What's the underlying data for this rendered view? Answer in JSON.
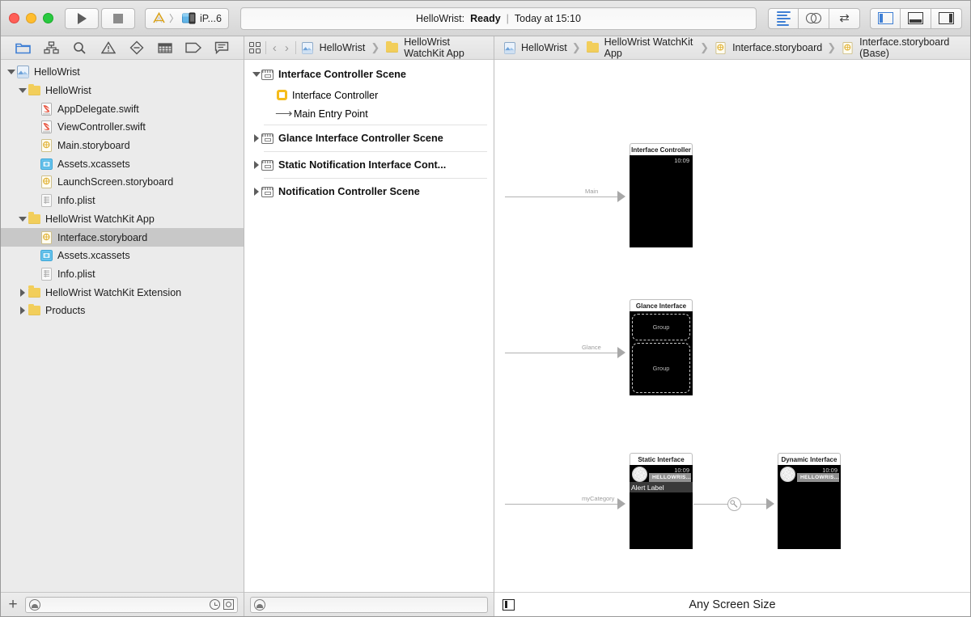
{
  "window": {
    "traffic_lights": [
      "close",
      "minimize",
      "zoom"
    ]
  },
  "toolbar": {
    "run_label": "Run",
    "stop_label": "Stop",
    "scheme": {
      "app_name": "HelloWrist",
      "separator": "〉",
      "destination": "iP...6"
    },
    "status": {
      "project": "HelloWrist:",
      "state": "Ready",
      "divider": "|",
      "time": "Today at 15:10"
    },
    "editor_modes": [
      {
        "name": "standard-editor",
        "icon": "lines-icon",
        "active": true
      },
      {
        "name": "assistant-editor",
        "icon": "venn-icon",
        "active": false
      },
      {
        "name": "version-editor",
        "icon": "arrows-icon",
        "active": false
      }
    ],
    "view_toggles": [
      {
        "name": "navigator-toggle",
        "icon": "left-pane-icon",
        "active": true
      },
      {
        "name": "debug-toggle",
        "icon": "bottom-pane-icon",
        "active": false
      },
      {
        "name": "utilities-toggle",
        "icon": "right-pane-icon",
        "active": false
      }
    ]
  },
  "navigator": {
    "tabs": [
      {
        "name": "project-navigator",
        "icon": "folder-icon",
        "active": true
      },
      {
        "name": "symbol-navigator",
        "icon": "hierarchy-icon",
        "active": false
      },
      {
        "name": "find-navigator",
        "icon": "search-icon",
        "active": false
      },
      {
        "name": "issue-navigator",
        "icon": "warning-icon",
        "active": false
      },
      {
        "name": "test-navigator",
        "icon": "diamond-icon",
        "active": false
      },
      {
        "name": "debug-navigator",
        "icon": "debug-icon",
        "active": false
      },
      {
        "name": "breakpoint-navigator",
        "icon": "tag-icon",
        "active": false
      },
      {
        "name": "report-navigator",
        "icon": "speech-icon",
        "active": false
      }
    ],
    "tree": [
      {
        "label": "HelloWrist",
        "indent": 0,
        "twisty": "down",
        "icon": "project-icon",
        "selected": false
      },
      {
        "label": "HelloWrist",
        "indent": 1,
        "twisty": "down",
        "icon": "folder-icon",
        "selected": false
      },
      {
        "label": "AppDelegate.swift",
        "indent": 2,
        "twisty": "none",
        "icon": "swift-icon",
        "selected": false
      },
      {
        "label": "ViewController.swift",
        "indent": 2,
        "twisty": "none",
        "icon": "swift-icon",
        "selected": false
      },
      {
        "label": "Main.storyboard",
        "indent": 2,
        "twisty": "none",
        "icon": "storyboard-icon",
        "selected": false
      },
      {
        "label": "Assets.xcassets",
        "indent": 2,
        "twisty": "none",
        "icon": "xcassets-icon",
        "selected": false
      },
      {
        "label": "LaunchScreen.storyboard",
        "indent": 2,
        "twisty": "none",
        "icon": "storyboard-icon",
        "selected": false
      },
      {
        "label": "Info.plist",
        "indent": 2,
        "twisty": "none",
        "icon": "plist-icon",
        "selected": false
      },
      {
        "label": "HelloWrist WatchKit App",
        "indent": 1,
        "twisty": "down",
        "icon": "folder-icon",
        "selected": false
      },
      {
        "label": "Interface.storyboard",
        "indent": 2,
        "twisty": "none",
        "icon": "storyboard-icon",
        "selected": true
      },
      {
        "label": "Assets.xcassets",
        "indent": 2,
        "twisty": "none",
        "icon": "xcassets-icon",
        "selected": false
      },
      {
        "label": "Info.plist",
        "indent": 2,
        "twisty": "none",
        "icon": "plist-icon",
        "selected": false
      },
      {
        "label": "HelloWrist WatchKit Extension",
        "indent": 1,
        "twisty": "right",
        "icon": "folder-icon",
        "selected": false
      },
      {
        "label": "Products",
        "indent": 1,
        "twisty": "right",
        "icon": "folder-icon",
        "selected": false
      }
    ],
    "bottom": {
      "add_label": "+",
      "filter_placeholder": ""
    }
  },
  "outline": {
    "jumpbar": {
      "back": "‹",
      "forward": "›",
      "crumbs": [
        "HelloWrist",
        "HelloWrist WatchKit App"
      ]
    },
    "items": [
      {
        "label": "Interface Controller Scene",
        "type": "scene",
        "twisty": "down",
        "icon": "scene-icon"
      },
      {
        "label": "Interface Controller",
        "type": "child",
        "twisty": "none",
        "icon": "interface-controller-icon"
      },
      {
        "label": "Main Entry Point",
        "type": "child",
        "twisty": "none",
        "icon": "entry-point-icon"
      },
      {
        "label": "Glance Interface Controller Scene",
        "type": "scene",
        "twisty": "right",
        "icon": "scene-icon"
      },
      {
        "label": "Static Notification Interface Cont...",
        "type": "scene",
        "twisty": "right",
        "icon": "scene-icon"
      },
      {
        "label": "Notification Controller Scene",
        "type": "scene",
        "twisty": "right",
        "icon": "scene-icon"
      }
    ],
    "bottom": {
      "filter_placeholder": ""
    }
  },
  "canvas_breadcrumb": {
    "crumbs": [
      "HelloWrist",
      "HelloWrist WatchKit App",
      "Interface.storyboard",
      "Interface.storyboard (Base)"
    ],
    "separator": "›"
  },
  "canvas": {
    "scenes": [
      {
        "name": "interface-controller-scene",
        "title": "Interface Controller",
        "time": "10:09",
        "arrow_label": "Main"
      },
      {
        "name": "glance-interface-scene",
        "title": "Glance Interface",
        "arrow_label": "Glance",
        "groups": [
          "Group",
          "Group"
        ]
      },
      {
        "name": "static-notification-scene",
        "title": "Static Interface",
        "time": "10:09",
        "app_name": "HELLOWRIS...",
        "alert_label": "Alert Label",
        "arrow_label": "myCategory"
      },
      {
        "name": "dynamic-notification-scene",
        "title": "Dynamic Interface",
        "time": "10:09",
        "app_name": "HELLOWRIS..."
      }
    ],
    "bottom_label": "Any Screen Size"
  },
  "colors": {
    "accent": "#3f7fd4",
    "selection": "#c8c8c8",
    "folder": "#f2ce5b",
    "interface_controller": "#f5bc1b"
  }
}
